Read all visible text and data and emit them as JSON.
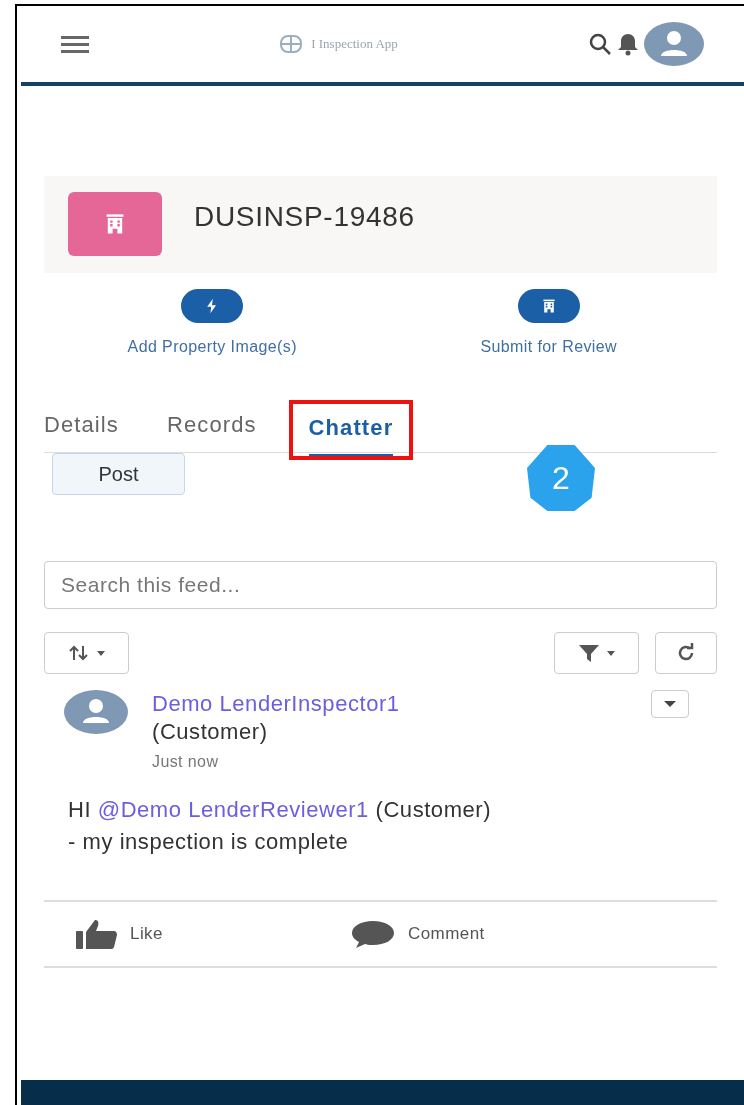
{
  "header": {
    "app_title": "I Inspection App"
  },
  "record": {
    "title": "DUSINSP-19486"
  },
  "actions": [
    {
      "kind": "bolt",
      "label": "Add Property Image(s)"
    },
    {
      "kind": "building",
      "label": "Submit for Review"
    }
  ],
  "tabs": [
    {
      "label": "Details",
      "selected": false
    },
    {
      "label": "Records",
      "selected": false
    },
    {
      "label": "Chatter",
      "selected": true
    }
  ],
  "callout": {
    "label": "2"
  },
  "publisher": {
    "post_button": "Post"
  },
  "feed": {
    "search": {
      "placeholder": "Search this feed..."
    },
    "post": {
      "author": "Demo LenderInspector1",
      "author_role": "(Customer)",
      "time": "Just now",
      "message": [
        {
          "kind": "text",
          "text": "HI "
        },
        {
          "kind": "mention",
          "text": "@Demo LenderReviewer1"
        },
        {
          "kind": "text",
          "text": " (Customer) - my inspection is complete"
        }
      ],
      "actions": [
        {
          "kind": "like",
          "label": "Like"
        },
        {
          "kind": "comment",
          "label": "Comment"
        }
      ]
    }
  }
}
